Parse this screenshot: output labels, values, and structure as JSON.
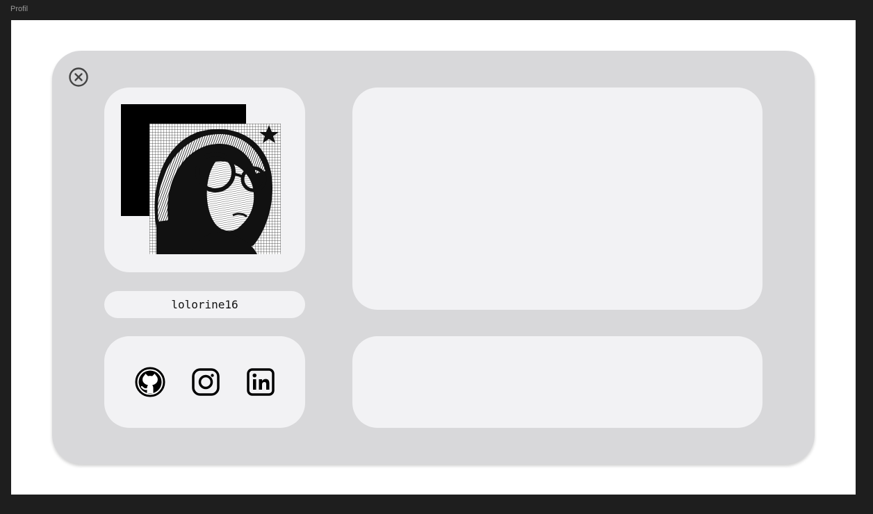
{
  "window": {
    "frame_label": "Profil"
  },
  "profile": {
    "username": "lolorine16",
    "avatar_alt": "avatar illustration"
  },
  "social": {
    "items": [
      {
        "name": "github-icon"
      },
      {
        "name": "instagram-icon"
      },
      {
        "name": "linkedin-icon"
      }
    ]
  },
  "colors": {
    "page_bg": "#1e1e1e",
    "frame_bg": "#ffffff",
    "card_bg": "#d8d8da",
    "panel_bg": "#f2f2f4",
    "ink": "#111111"
  }
}
